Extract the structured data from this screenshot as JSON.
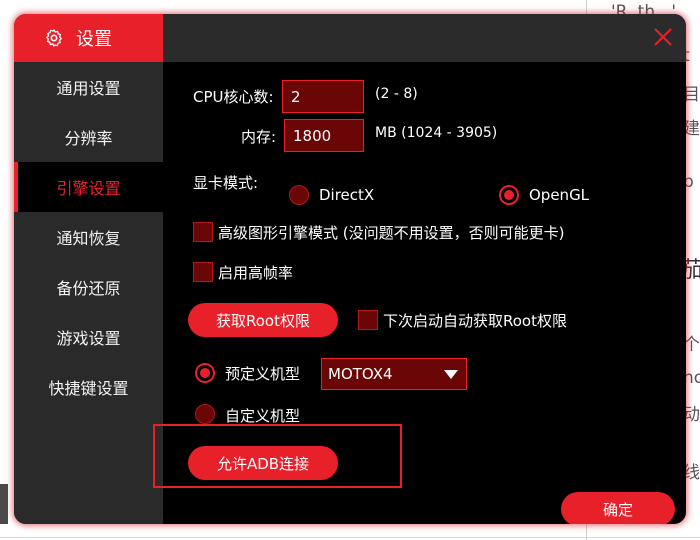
{
  "dialog": {
    "title": "设置",
    "close_label": "×"
  },
  "sidebar": {
    "items": [
      {
        "label": "通用设置"
      },
      {
        "label": "分辨率"
      },
      {
        "label": "引擎设置",
        "active": true
      },
      {
        "label": "通知恢复"
      },
      {
        "label": "备份还原"
      },
      {
        "label": "游戏设置"
      },
      {
        "label": "快捷键设置"
      }
    ]
  },
  "engine": {
    "cpu_label": "CPU核心数:",
    "cpu_value": "2",
    "cpu_range": "(2 - 8)",
    "memory_label": "内存:",
    "memory_value": "1800",
    "memory_range": "MB   (1024 - 3905)",
    "gpu_label": "显卡模式:",
    "gpu_options": [
      {
        "label": "DirectX",
        "selected": false
      },
      {
        "label": "OpenGL",
        "selected": true
      }
    ],
    "advanced_engine_label": "高级图形引擎模式 (没问题不用设置，否则可能更卡)",
    "high_fps_label": "启用高帧率",
    "root_button": "获取Root权限",
    "auto_root_label": "下次启动自动获取Root权限",
    "predefined_model_label": "预定义机型",
    "predefined_model_value": "MOTOX4",
    "custom_model_label": "自定义机型",
    "adb_button": "允许ADB连接",
    "confirm_button": "确定"
  },
  "background": {
    "fragments": [
      "'R..th...'",
      "t",
      "目",
      "建",
      "p",
      "茄",
      "个",
      "no",
      "动",
      "线"
    ]
  },
  "colors": {
    "accent": "#e8202a",
    "field_bg": "#6a0606",
    "sidebar_bg": "#2a2a2a"
  }
}
